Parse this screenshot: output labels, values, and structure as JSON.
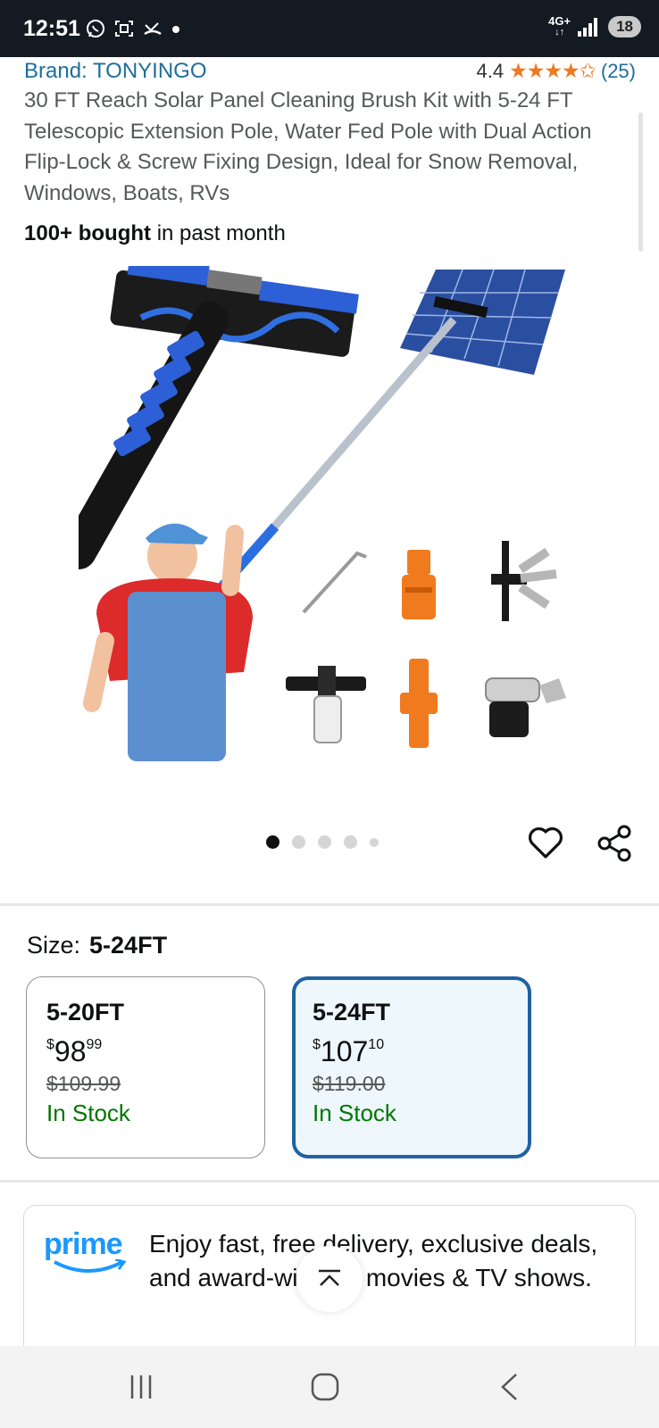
{
  "status_bar": {
    "time": "12:51",
    "network": "4G+",
    "battery": "18",
    "icons": [
      "whatsapp-icon",
      "screenshot-icon",
      "missed-call-icon",
      "notification-dot-icon"
    ]
  },
  "product": {
    "brand": "Brand: TONYINGO",
    "rating": "4.4",
    "stars": "★★★★✩",
    "review_count": "(25)",
    "title": "30 FT Reach Solar Panel Cleaning Brush Kit with 5-24 FT Telescopic Extension Pole, Water Fed Pole with Dual Action Flip-Lock & Screw Fixing Design, Ideal for Snow Removal, Windows, Boats, RVs",
    "bought_bold": "100+ bought",
    "bought_rest": "in past month"
  },
  "carousel": {
    "total_dots": 5,
    "active_index": 0
  },
  "size": {
    "label": "Size:",
    "selected": "5-24FT",
    "options": [
      {
        "name": "5-20FT",
        "currency": "$",
        "price_whole": "98",
        "price_cents": "99",
        "list_price": "$109.99",
        "stock": "In Stock"
      },
      {
        "name": "5-24FT",
        "currency": "$",
        "price_whole": "107",
        "price_cents": "10",
        "list_price": "$119.00",
        "stock": "In Stock"
      }
    ]
  },
  "prime": {
    "logo_text": "prime",
    "message": "Enjoy fast, free delivery, exclusive deals, and award-winning movies & TV shows."
  },
  "colors": {
    "link_blue": "#1f6d9c",
    "star_orange": "#f0781e",
    "selected_border": "#2162a1",
    "stock_green": "#007600",
    "prime_blue": "#1a98ff",
    "status_bg": "#131a22"
  }
}
